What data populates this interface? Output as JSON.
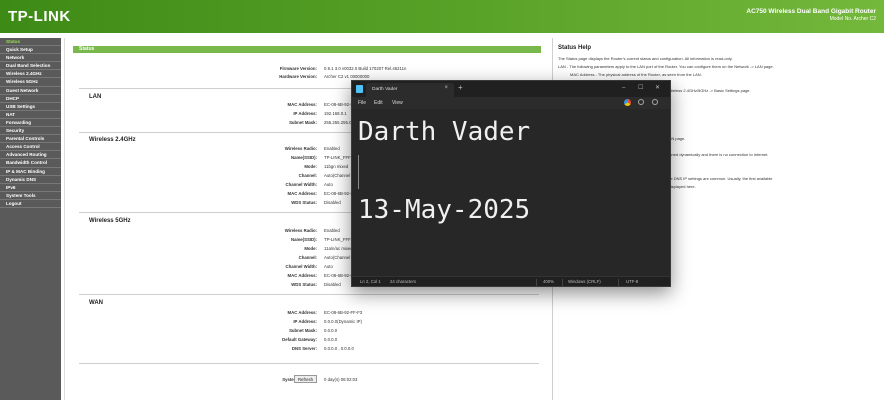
{
  "header": {
    "logo": "TP-LINK",
    "product_title": "AC750 Wireless Dual Band Gigabit Router",
    "model": "Model No. Archer C2"
  },
  "sidebar": {
    "items": [
      {
        "label": "Status",
        "active": true
      },
      {
        "label": "Quick Setup"
      },
      {
        "label": "Network"
      },
      {
        "label": "Dual Band Selection"
      },
      {
        "label": "Wireless 2.4GHz"
      },
      {
        "label": "Wireless 5GHz"
      },
      {
        "label": "Guest Network"
      },
      {
        "label": "DHCP"
      },
      {
        "label": "USB Settings"
      },
      {
        "label": "NAT"
      },
      {
        "label": "Forwarding"
      },
      {
        "label": "Security"
      },
      {
        "label": "Parental Controls"
      },
      {
        "label": "Access Control"
      },
      {
        "label": "Advanced Routing"
      },
      {
        "label": "Bandwidth Control"
      },
      {
        "label": "IP & MAC Binding"
      },
      {
        "label": "Dynamic DNS"
      },
      {
        "label": "IPv6"
      },
      {
        "label": "System Tools"
      },
      {
        "label": "Logout"
      }
    ]
  },
  "main": {
    "title": "Status",
    "firmware": {
      "label": "Firmware Version:",
      "value": "0.9.1 3.0 v0032.0 Build 170207 Rel.46211n"
    },
    "hardware": {
      "label": "Hardware Version:",
      "value": "Archer C2 v1 00000000"
    },
    "lan": {
      "title": "LAN",
      "rows": [
        {
          "label": "MAC Address:",
          "value": "EC-08-6B-92-FF-F2"
        },
        {
          "label": "IP Address:",
          "value": "192.168.0.1"
        },
        {
          "label": "Subnet Mask:",
          "value": "255.255.255.0"
        }
      ]
    },
    "wireless24": {
      "title": "Wireless 2.4GHz",
      "rows": [
        {
          "label": "Wireless Radio:",
          "value": "Enabled"
        },
        {
          "label": "Name(SSID):",
          "value": "TP-LINK_FFF2"
        },
        {
          "label": "Mode:",
          "value": "11bgn mixed"
        },
        {
          "label": "Channel:",
          "value": "Auto(Channel 10)"
        },
        {
          "label": "Channel Width:",
          "value": "Auto"
        },
        {
          "label": "MAC Address:",
          "value": "EC-08-6B-92-FF-F2"
        },
        {
          "label": "WDS Status:",
          "value": "Disabled"
        }
      ]
    },
    "wireless5": {
      "title": "Wireless 5GHz",
      "rows": [
        {
          "label": "Wireless Radio:",
          "value": "Enabled"
        },
        {
          "label": "Name(SSID):",
          "value": "TP-LINK_FFF2_5G"
        },
        {
          "label": "Mode:",
          "value": "11a/n/ac mixed"
        },
        {
          "label": "Channel:",
          "value": "Auto(Channel 36)"
        },
        {
          "label": "Channel Width:",
          "value": "Auto"
        },
        {
          "label": "MAC Address:",
          "value": "EC-08-6B-92-FF-F1"
        },
        {
          "label": "WDS Status:",
          "value": "Disabled"
        }
      ]
    },
    "wan": {
      "title": "WAN",
      "rows": [
        {
          "label": "MAC Address:",
          "value": "EC-08-6B-92-FF-F3"
        },
        {
          "label": "IP Address:",
          "value": "0.0.0.0(Dynamic IP)"
        },
        {
          "label": "Subnet Mask:",
          "value": "0.0.0.0"
        },
        {
          "label": "Default Gateway:",
          "value": "0.0.0.0"
        },
        {
          "label": "DNS Server:",
          "value": "0.0.0.0 , 0.0.0.0"
        }
      ]
    },
    "uptime": {
      "label": "System Up Time:",
      "value": "0 day(s) 06:02:03",
      "button": "Refresh"
    }
  },
  "help": {
    "title": "Status Help",
    "lines": [
      "The Status page displays the Router's current status and configuration. All information is read-only.",
      "LAN - The following parameters apply to the LAN port of the Router. You can configure them on the Network -> LAN page.",
      "MAC Address - The physical address of the Router, as seen from the LAN.",
      "IP Address - The LAN IP address.",
      "information for Wireless You can configure them in the Wireless 2.4GHz/5GHz -> Basic Settings page.",
      "feature of the Router is enabled or disabled.",
      "works on.",
      "nel.",
      "s, as seen from the WLAN.",
      "isplayed.",
      "the Router. You can configure them in the Network -> WAN page.",
      "er, as seen from the Internet.",
      "This field will be blank or 0.0.0.0 if the IP Address is assigned dynamically and there is no connection to Internet.",
      "WAN IP Address.",
      "the Router is shown here.",
      "server IP addresses currently used by the Router. Multiple DNS IP settings are common. Usually, the first available",
      "you PPPoE as WAN connection type, the online time is displayed here.",
      "shown in this area.",
      "ast powered on or reset.",
      "of the Router."
    ]
  },
  "notepad": {
    "tab_title": "Darth Vader",
    "menu": [
      "File",
      "Edit",
      "View"
    ],
    "line1": "Darth Vader",
    "line3": "13-May-2025",
    "status": {
      "position": "Ln 2, Col 1",
      "characters": "24 characters",
      "zoom": "400%",
      "line_ending": "Windows (CRLF)",
      "encoding": "UTF-8"
    }
  }
}
